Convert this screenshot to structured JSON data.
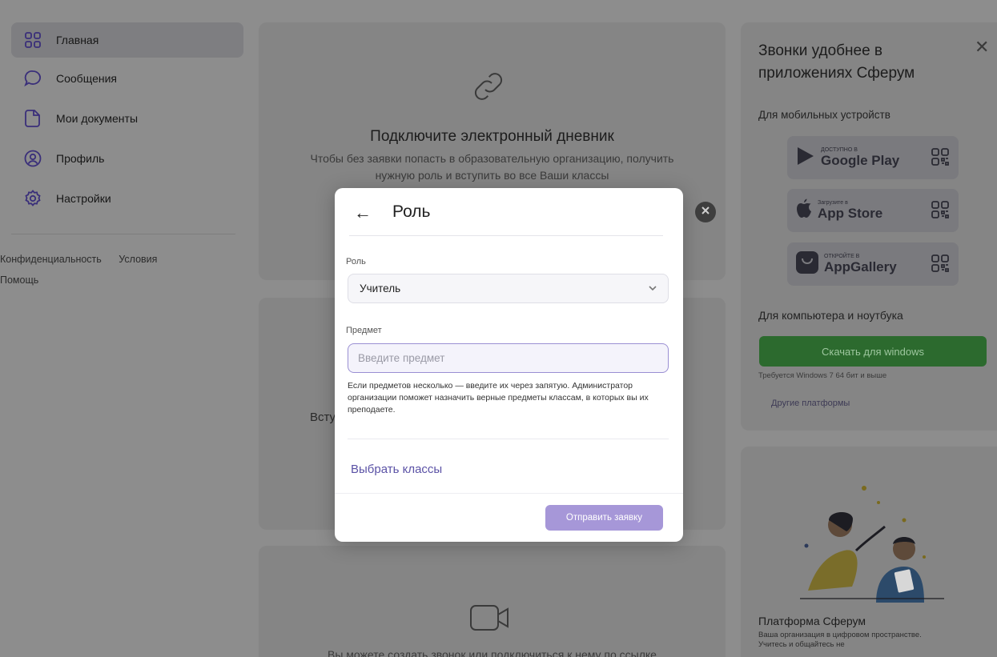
{
  "sidebar": {
    "items": [
      {
        "label": "Главная",
        "icon": "grid-icon"
      },
      {
        "label": "Сообщения",
        "icon": "chat-bubble-icon"
      },
      {
        "label": "Мои документы",
        "icon": "document-icon"
      },
      {
        "label": "Профиль",
        "icon": "profile-icon"
      },
      {
        "label": "Настройки",
        "icon": "settings-gear-icon"
      }
    ],
    "footer": {
      "privacy": "Конфиденциальность",
      "terms": "Условия",
      "help": "Помощь"
    }
  },
  "main": {
    "diary_card": {
      "title": "Подключите электронный дневник",
      "subtitle": "Чтобы без заявки попасть в образовательную организацию, получить нужную роль и вступить во все Ваши классы"
    },
    "join_card": {
      "text": "Всту"
    },
    "call_card": {
      "text": "Вы можете создать звонок или подключиться к нему по ссылке"
    }
  },
  "right_panel": {
    "title": "Звонки удобнее в приложениях Сферум",
    "mobile_label": "Для мобильных устройств",
    "stores": [
      {
        "small": "ДОСТУПНО В",
        "name": "Google Play",
        "icon": "google-play-icon"
      },
      {
        "small": "Загрузите в",
        "name": "App Store",
        "icon": "apple-icon"
      },
      {
        "small": "ОТКРОЙТЕ В",
        "name": "AppGallery",
        "icon": "huawei-appgallery-icon"
      }
    ],
    "desktop_label": "Для компьютера и ноутбука",
    "download_button": "Скачать для windows",
    "requirements": "Требуется Windows 7 64 бит и выше",
    "other_platforms": "Другие платформы",
    "platform_title": "Платформа Сферум",
    "platform_sub": "Ваша организация в цифровом пространстве. Учитесь и общайтесь не"
  },
  "modal": {
    "title": "Роль",
    "role_label": "Роль",
    "role_value": "Учитель",
    "subject_label": "Предмет",
    "subject_placeholder": "Введите предмет",
    "hint": "Если предметов несколько — введите их через запятую. Администратор организации поможет назначить верные предметы классам, в которых вы их преподаете.",
    "choose_classes": "Выбрать классы",
    "submit": "Отправить заявку"
  },
  "colors": {
    "accent": "#a697d8",
    "link": "#5b52a6",
    "download_green": "#2c6a2e",
    "overlay": "#8d8d8d"
  }
}
